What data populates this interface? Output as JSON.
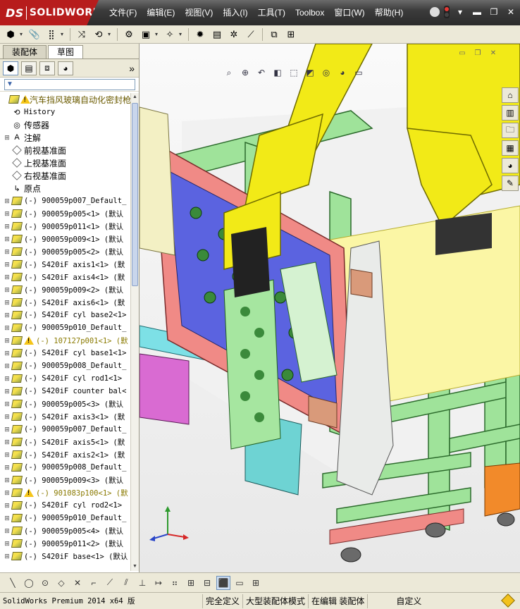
{
  "app": {
    "brand": "SOLIDWORKS",
    "brand_prefix": "DS"
  },
  "menu": [
    "文件(F)",
    "编辑(E)",
    "视图(V)",
    "插入(I)",
    "工具(T)",
    "Toolbox",
    "窗口(W)",
    "帮助(H)"
  ],
  "left_pane": {
    "tabs": [
      "装配体",
      "草图"
    ],
    "active_tab": "装配体",
    "tree": [
      {
        "label": "汽车挡风玻璃自动化密封枪",
        "icon": "assembly-icon",
        "warning": true,
        "top": true
      },
      {
        "label": "History",
        "icon": "history-icon"
      },
      {
        "label": "传感器",
        "icon": "sensor-icon"
      },
      {
        "label": "注解",
        "icon": "annotation-icon",
        "expand": true
      },
      {
        "label": "前视基准面",
        "icon": "plane-icon"
      },
      {
        "label": "上视基准面",
        "icon": "plane-icon"
      },
      {
        "label": "右视基准面",
        "icon": "plane-icon"
      },
      {
        "label": "原点",
        "icon": "origin-icon"
      },
      {
        "label": "(-) 900059p007_Default_",
        "icon": "assembly-icon",
        "expand": true
      },
      {
        "label": "(-) 900059p005<1> (默认",
        "icon": "assembly-icon",
        "expand": true
      },
      {
        "label": "(-) 900059p011<1> (默认",
        "icon": "assembly-icon",
        "expand": true
      },
      {
        "label": "(-) 900059p009<1> (默认",
        "icon": "assembly-icon",
        "expand": true
      },
      {
        "label": "(-) 900059p005<2> (默认",
        "icon": "assembly-icon",
        "expand": true
      },
      {
        "label": "(-) S420iF axis1<1> (默",
        "icon": "assembly-icon",
        "expand": true
      },
      {
        "label": "(-) S420iF axis4<1> (默",
        "icon": "assembly-icon",
        "expand": true
      },
      {
        "label": "(-) 900059p009<2> (默认",
        "icon": "assembly-icon",
        "expand": true
      },
      {
        "label": "(-) S420iF axis6<1> (默",
        "icon": "assembly-icon",
        "expand": true
      },
      {
        "label": "(-) S420iF cyl base2<1>",
        "icon": "assembly-icon",
        "expand": true
      },
      {
        "label": "(-) 900059p010_Default_",
        "icon": "assembly-icon",
        "expand": true
      },
      {
        "label": "(-) 107127p001<1> (默",
        "icon": "assembly-icon",
        "expand": true,
        "warning": true
      },
      {
        "label": "(-) S420iF cyl base1<1>",
        "icon": "assembly-icon",
        "expand": true
      },
      {
        "label": "(-) 900059p008_Default_",
        "icon": "assembly-icon",
        "expand": true
      },
      {
        "label": "(-) S420iF cyl rod1<1>",
        "icon": "assembly-icon",
        "expand": true
      },
      {
        "label": "(-) S420iF counter bal<",
        "icon": "assembly-icon",
        "expand": true
      },
      {
        "label": "(-) 900059p005<3> (默认",
        "icon": "assembly-icon",
        "expand": true
      },
      {
        "label": "(-) S420iF axis3<1> (默",
        "icon": "assembly-icon",
        "expand": true
      },
      {
        "label": "(-) 900059p007_Default_",
        "icon": "assembly-icon",
        "expand": true
      },
      {
        "label": "(-) S420iF axis5<1> (默",
        "icon": "assembly-icon",
        "expand": true
      },
      {
        "label": "(-) S420iF axis2<1> (默",
        "icon": "assembly-icon",
        "expand": true
      },
      {
        "label": "(-) 900059p008_Default_",
        "icon": "assembly-icon",
        "expand": true
      },
      {
        "label": "(-) 900059p009<3> (默认",
        "icon": "assembly-icon",
        "expand": true
      },
      {
        "label": "(-) 901083p100<1> (默",
        "icon": "assembly-icon",
        "expand": true,
        "warning": true
      },
      {
        "label": "(-) S420iF cyl rod2<1>",
        "icon": "assembly-icon",
        "expand": true
      },
      {
        "label": "(-) 900059p010_Default_",
        "icon": "assembly-icon",
        "expand": true
      },
      {
        "label": "(-) 900059p005<4> (默认",
        "icon": "assembly-icon",
        "expand": true
      },
      {
        "label": "(-) 900059p011<2> (默认",
        "icon": "assembly-icon",
        "expand": true
      },
      {
        "label": "(-) S420iF base<1> (默认",
        "icon": "assembly-icon",
        "expand": true
      }
    ]
  },
  "status_bar": {
    "product": "SolidWorks Premium 2014 x64 版",
    "definition": "完全定义",
    "mode": "大型装配体模式",
    "editing": "在编辑 装配体",
    "units": "自定义"
  },
  "colors": {
    "robot_yellow": "#f2ea17",
    "frame_green": "#9fe39a",
    "plate_blue": "#5b63e0",
    "plate_red": "#f08a86"
  }
}
